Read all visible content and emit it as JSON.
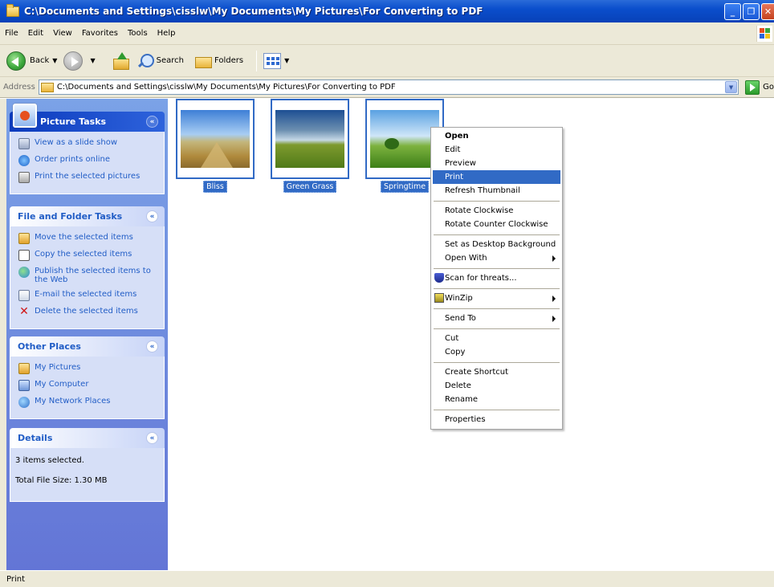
{
  "window": {
    "title": "C:\\Documents and Settings\\cisslw\\My Documents\\My Pictures\\For Converting to PDF"
  },
  "menu": [
    "File",
    "Edit",
    "View",
    "Favorites",
    "Tools",
    "Help"
  ],
  "toolbar": {
    "back_label": "Back",
    "search_label": "Search",
    "folders_label": "Folders"
  },
  "address": {
    "label": "Address",
    "value": "C:\\Documents and Settings\\cisslw\\My Documents\\My Pictures\\For Converting to PDF",
    "go_label": "Go"
  },
  "panels": {
    "picture_tasks": {
      "title": "Picture Tasks",
      "items": [
        "View as a slide show",
        "Order prints online",
        "Print the selected pictures"
      ]
    },
    "file_folder_tasks": {
      "title": "File and Folder Tasks",
      "items": [
        "Move the selected items",
        "Copy the selected items",
        "Publish the selected items to the Web",
        "E-mail the selected items",
        "Delete the selected items"
      ]
    },
    "other_places": {
      "title": "Other Places",
      "items": [
        "My Pictures",
        "My Computer",
        "My Network Places"
      ]
    },
    "details": {
      "title": "Details",
      "selected": "3 items selected.",
      "size": "Total File Size: 1.30 MB"
    }
  },
  "files": [
    {
      "name": "Bliss"
    },
    {
      "name": "Green Grass"
    },
    {
      "name": "Springtime"
    }
  ],
  "context_menu": {
    "open": "Open",
    "edit": "Edit",
    "preview": "Preview",
    "print": "Print",
    "refresh": "Refresh Thumbnail",
    "rotate_cw": "Rotate Clockwise",
    "rotate_ccw": "Rotate Counter Clockwise",
    "desktop_bg": "Set as Desktop Background",
    "open_with": "Open With",
    "scan": "Scan for threats...",
    "winzip": "WinZip",
    "send_to": "Send To",
    "cut": "Cut",
    "copy": "Copy",
    "create_shortcut": "Create Shortcut",
    "delete": "Delete",
    "rename": "Rename",
    "properties": "Properties"
  },
  "status": {
    "text": "Print"
  },
  "colors": {
    "selection": "#316ac5",
    "title_bar": "#0a4ecc",
    "task_link": "#215dc6"
  }
}
